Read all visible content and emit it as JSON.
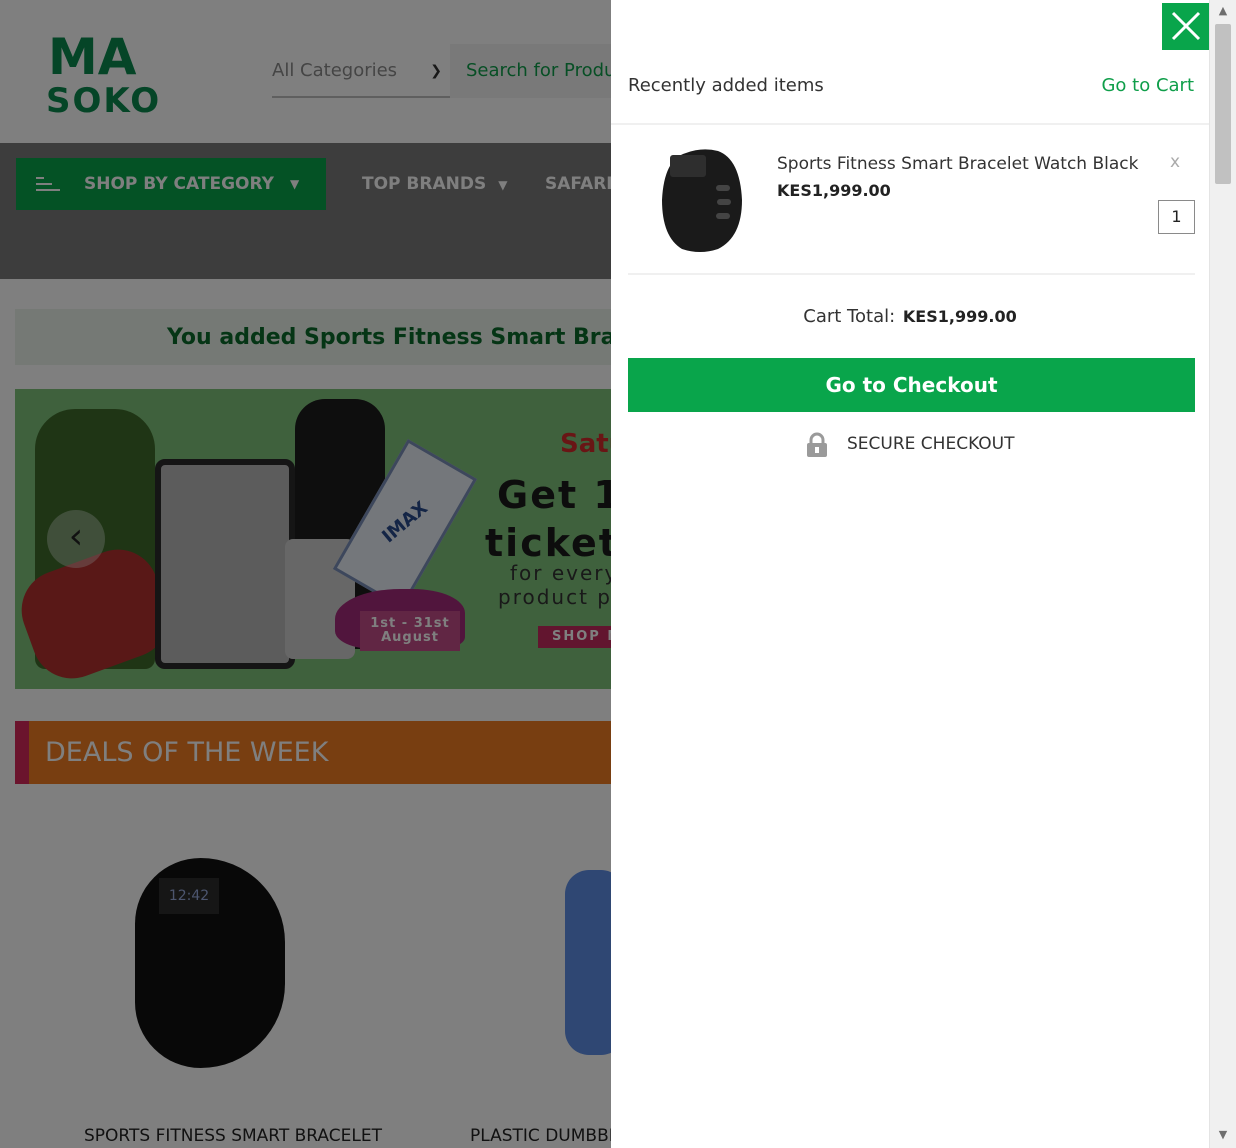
{
  "header": {
    "logo_top": "MA",
    "logo_bottom": "SOKO",
    "category_select": "All Categories",
    "search_placeholder": "Search for Produ"
  },
  "nav": {
    "shop_by_category": "SHOP BY CATEGORY",
    "top_brands": "TOP BRANDS",
    "safaricom": "SAFARIC"
  },
  "notice": "You added Sports Fitness Smart Bracel",
  "banner": {
    "promo_red": "Satu",
    "promo_line1": "Get 1",
    "promo_line2": "ticket",
    "promo_small1": "for every",
    "promo_small2": "product p",
    "ticket_text": "IMAX",
    "date_line1": "1st - 31st",
    "date_line2": "August",
    "shop_now": "SHOP N"
  },
  "deals": {
    "title": "DEALS OF THE WEEK",
    "products": [
      {
        "name": "SPORTS FITNESS SMART BRACELET"
      },
      {
        "name": "PLASTIC DUMBBE"
      }
    ],
    "band_time": "12:42"
  },
  "cart": {
    "title": "Recently added items",
    "go_to_cart": "Go to Cart",
    "items": [
      {
        "name": "Sports Fitness Smart Bracelet Watch Black",
        "price": "KES1,999.00",
        "qty": "1",
        "remove": "x"
      }
    ],
    "total_label": "Cart Total:",
    "total_value": "KES1,999.00",
    "checkout_label": "Go to Checkout",
    "secure_label": "SECURE CHECKOUT"
  },
  "colors": {
    "brand_green": "#09a54b",
    "deals_orange": "#f07c22"
  }
}
